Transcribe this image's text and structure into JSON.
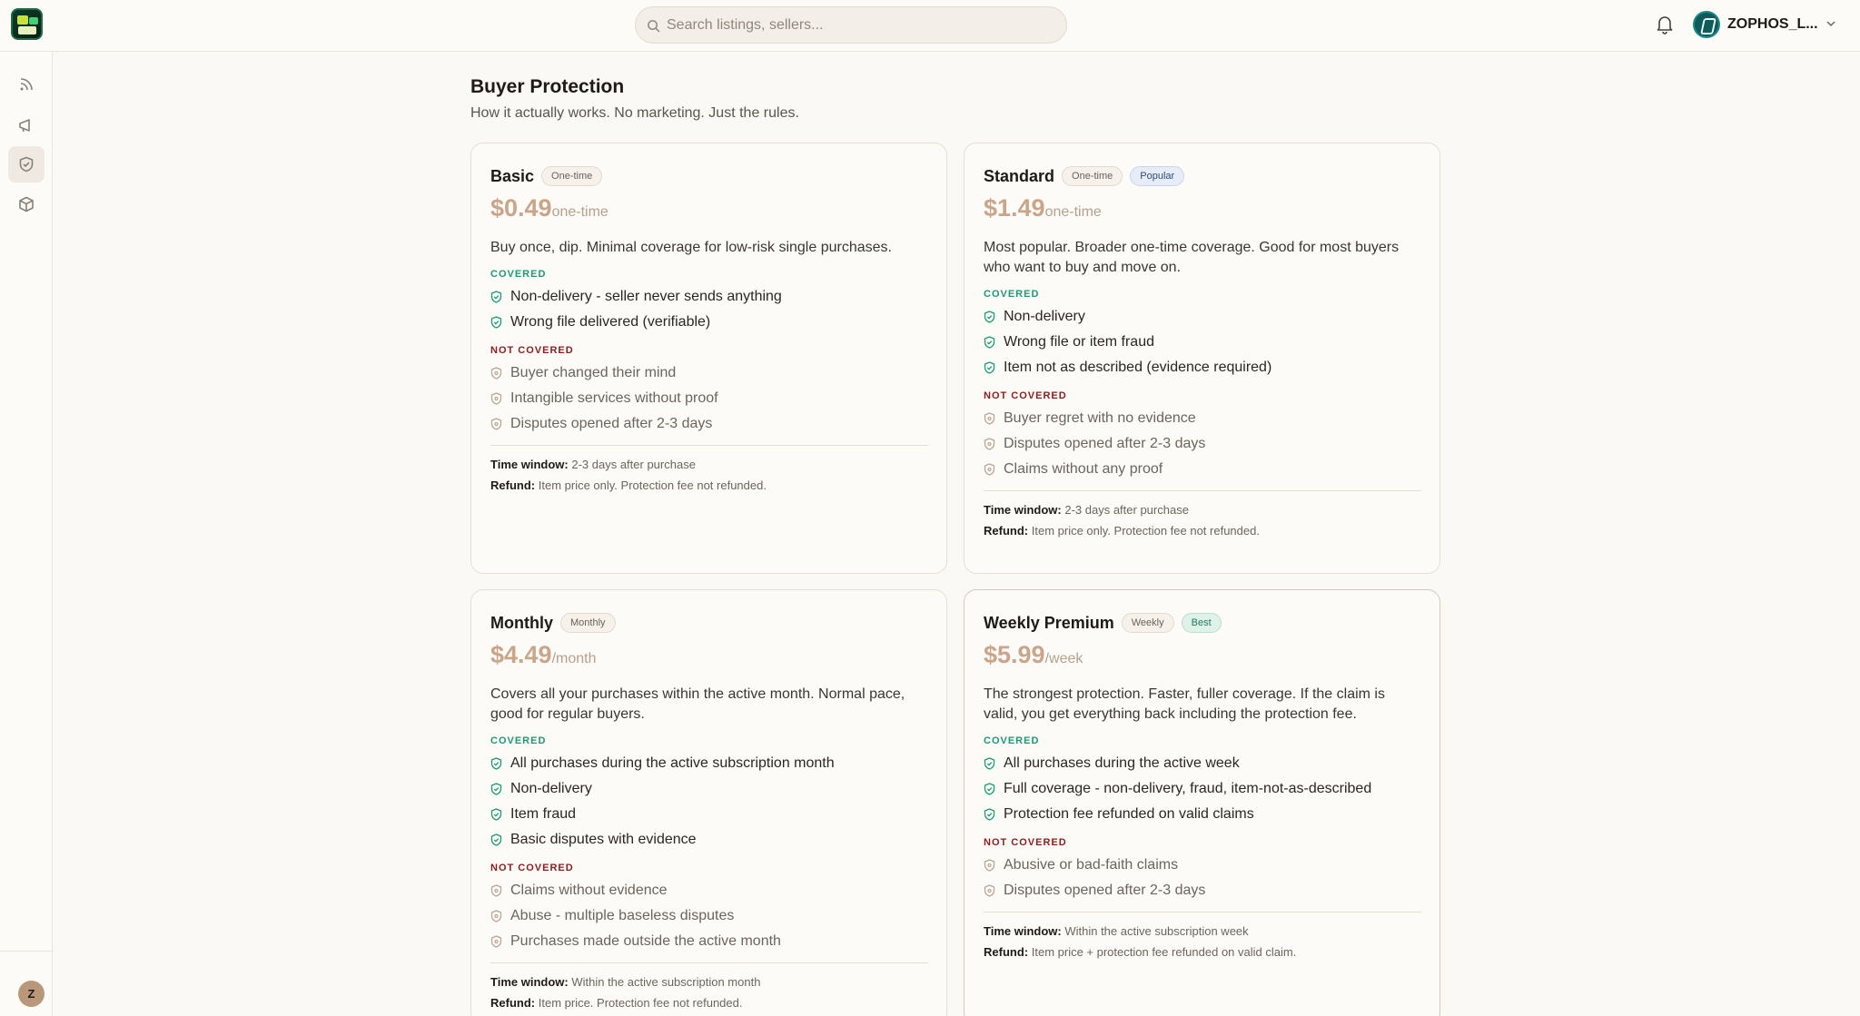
{
  "search": {
    "placeholder": "Search listings, sellers..."
  },
  "user": {
    "name": "ZOPHOS_L..."
  },
  "sidebar": {
    "items": [
      {
        "icon": "rss-icon"
      },
      {
        "icon": "megaphone-icon"
      },
      {
        "icon": "shield-icon",
        "active": true
      },
      {
        "icon": "box-icon"
      }
    ],
    "avatar_initial": "Z"
  },
  "page": {
    "title": "Buyer Protection",
    "subtitle": "How it actually works. No marketing. Just the rules."
  },
  "labels": {
    "covered": "COVERED",
    "not_covered": "NOT COVERED",
    "time_window": "Time window:",
    "refund": "Refund:"
  },
  "colors": {
    "accent_price": "#c9a58a",
    "covered": "#1b9a74",
    "not_covered": "#8c1d1d"
  },
  "plans": [
    {
      "name": "Basic",
      "badges": [
        "One-time"
      ],
      "price": "$0.49",
      "period": "one-time",
      "description": "Buy once, dip. Minimal coverage for low-risk single purchases.",
      "covered": [
        "Non-delivery - seller never sends anything",
        "Wrong file delivered (verifiable)"
      ],
      "not_covered": [
        "Buyer changed their mind",
        "Intangible services without proof",
        "Disputes opened after 2-3 days"
      ],
      "time_window": "2-3 days after purchase",
      "refund": "Item price only. Protection fee not refunded."
    },
    {
      "name": "Standard",
      "badges": [
        "One-time",
        "Popular"
      ],
      "price": "$1.49",
      "period": "one-time",
      "description": "Most popular. Broader one-time coverage. Good for most buyers who want to buy and move on.",
      "covered": [
        "Non-delivery",
        "Wrong file or item fraud",
        "Item not as described (evidence required)"
      ],
      "not_covered": [
        "Buyer regret with no evidence",
        "Disputes opened after 2-3 days",
        "Claims without any proof"
      ],
      "time_window": "2-3 days after purchase",
      "refund": "Item price only. Protection fee not refunded."
    },
    {
      "name": "Monthly",
      "badges": [
        "Monthly"
      ],
      "price": "$4.49",
      "period": "/month",
      "description": "Covers all your purchases within the active month. Normal pace, good for regular buyers.",
      "covered": [
        "All purchases during the active subscription month",
        "Non-delivery",
        "Item fraud",
        "Basic disputes with evidence"
      ],
      "not_covered": [
        "Claims without evidence",
        "Abuse - multiple baseless disputes",
        "Purchases made outside the active month"
      ],
      "time_window": "Within the active subscription month",
      "refund": "Item price. Protection fee not refunded."
    },
    {
      "name": "Weekly Premium",
      "badges": [
        "Weekly",
        "Best"
      ],
      "price": "$5.99",
      "period": "/week",
      "description": "The strongest protection. Faster, fuller coverage. If the claim is valid, you get everything back including the protection fee.",
      "covered": [
        "All purchases during the active week",
        "Full coverage - non-delivery, fraud, item-not-as-described",
        "Protection fee refunded on valid claims"
      ],
      "not_covered": [
        "Abusive or bad-faith claims",
        "Disputes opened after 2-3 days"
      ],
      "time_window": "Within the active subscription week",
      "refund": "Item price + protection fee refunded on valid claim."
    }
  ]
}
